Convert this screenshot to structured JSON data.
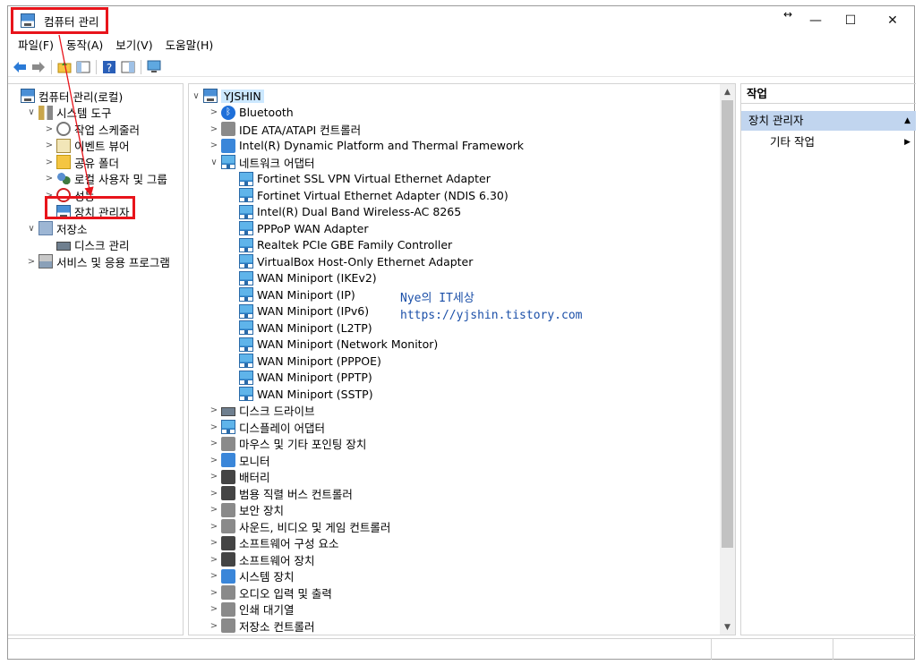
{
  "window": {
    "title": "컴퓨터 관리",
    "controls": {
      "restore": "↔",
      "minimize": "—",
      "maximize": "☐",
      "close": "✕"
    }
  },
  "menubar": [
    "파일(F)",
    "동작(A)",
    "보기(V)",
    "도움말(H)"
  ],
  "toolbar_icons": [
    "back-arrow-icon",
    "forward-arrow-icon",
    "up-folder-icon",
    "show-hide-tree-icon",
    "help-icon",
    "properties-icon",
    "monitor-icon"
  ],
  "left_tree": [
    {
      "label": "컴퓨터 관리(로컬)",
      "level": 0,
      "chev": "",
      "icon": "computer-management-icon"
    },
    {
      "label": "시스템 도구",
      "level": 1,
      "chev": "∨",
      "icon": "tools-icon"
    },
    {
      "label": "작업 스케줄러",
      "level": 2,
      "chev": ">",
      "icon": "clock-icon"
    },
    {
      "label": "이벤트 뷰어",
      "level": 2,
      "chev": ">",
      "icon": "event-viewer-icon"
    },
    {
      "label": "공유 폴더",
      "level": 2,
      "chev": ">",
      "icon": "shared-folder-icon"
    },
    {
      "label": "로컬 사용자 및 그룹",
      "level": 2,
      "chev": ">",
      "icon": "users-icon"
    },
    {
      "label": "성능",
      "level": 2,
      "chev": ">",
      "icon": "performance-icon"
    },
    {
      "label": "장치 관리자",
      "level": 2,
      "chev": "",
      "icon": "device-manager-icon",
      "selected": true
    },
    {
      "label": "저장소",
      "level": 1,
      "chev": "∨",
      "icon": "storage-icon"
    },
    {
      "label": "디스크 관리",
      "level": 2,
      "chev": "",
      "icon": "disk-icon"
    },
    {
      "label": "서비스 및 응용 프로그램",
      "level": 1,
      "chev": ">",
      "icon": "services-icon"
    }
  ],
  "device_tree": {
    "root": "YJSHIN",
    "items": [
      {
        "label": "Bluetooth",
        "level": 1,
        "chev": ">",
        "icon": "bluetooth-icon"
      },
      {
        "label": "IDE ATA/ATAPI 컨트롤러",
        "level": 1,
        "chev": ">",
        "icon": "ide-controller-icon"
      },
      {
        "label": "Intel(R) Dynamic Platform and Thermal Framework",
        "level": 1,
        "chev": ">",
        "icon": "framework-icon"
      },
      {
        "label": "네트워크 어댑터",
        "level": 1,
        "chev": "∨",
        "icon": "network-adapter-icon"
      },
      {
        "label": "Fortinet SSL VPN Virtual Ethernet Adapter",
        "level": 2,
        "chev": "",
        "icon": "network-adapter-icon"
      },
      {
        "label": "Fortinet Virtual Ethernet Adapter (NDIS 6.30)",
        "level": 2,
        "chev": "",
        "icon": "network-adapter-icon"
      },
      {
        "label": "Intel(R) Dual Band Wireless-AC 8265",
        "level": 2,
        "chev": "",
        "icon": "network-adapter-icon"
      },
      {
        "label": "PPPoP WAN Adapter",
        "level": 2,
        "chev": "",
        "icon": "network-adapter-icon"
      },
      {
        "label": "Realtek PCIe GBE Family Controller",
        "level": 2,
        "chev": "",
        "icon": "network-adapter-icon"
      },
      {
        "label": "VirtualBox Host-Only Ethernet Adapter",
        "level": 2,
        "chev": "",
        "icon": "network-adapter-icon"
      },
      {
        "label": "WAN Miniport (IKEv2)",
        "level": 2,
        "chev": "",
        "icon": "network-adapter-icon"
      },
      {
        "label": "WAN Miniport (IP)",
        "level": 2,
        "chev": "",
        "icon": "network-adapter-icon"
      },
      {
        "label": "WAN Miniport (IPv6)",
        "level": 2,
        "chev": "",
        "icon": "network-adapter-icon"
      },
      {
        "label": "WAN Miniport (L2TP)",
        "level": 2,
        "chev": "",
        "icon": "network-adapter-icon"
      },
      {
        "label": "WAN Miniport (Network Monitor)",
        "level": 2,
        "chev": "",
        "icon": "network-adapter-icon"
      },
      {
        "label": "WAN Miniport (PPPOE)",
        "level": 2,
        "chev": "",
        "icon": "network-adapter-icon"
      },
      {
        "label": "WAN Miniport (PPTP)",
        "level": 2,
        "chev": "",
        "icon": "network-adapter-icon"
      },
      {
        "label": "WAN Miniport (SSTP)",
        "level": 2,
        "chev": "",
        "icon": "network-adapter-icon"
      },
      {
        "label": "디스크 드라이브",
        "level": 1,
        "chev": ">",
        "icon": "disk-drive-icon"
      },
      {
        "label": "디스플레이 어댑터",
        "level": 1,
        "chev": ">",
        "icon": "display-adapter-icon"
      },
      {
        "label": "마우스 및 기타 포인팅 장치",
        "level": 1,
        "chev": ">",
        "icon": "mouse-icon"
      },
      {
        "label": "모니터",
        "level": 1,
        "chev": ">",
        "icon": "monitor-icon"
      },
      {
        "label": "배터리",
        "level": 1,
        "chev": ">",
        "icon": "battery-icon"
      },
      {
        "label": "범용 직렬 버스 컨트롤러",
        "level": 1,
        "chev": ">",
        "icon": "usb-icon"
      },
      {
        "label": "보안 장치",
        "level": 1,
        "chev": ">",
        "icon": "security-device-icon"
      },
      {
        "label": "사운드, 비디오 및 게임 컨트롤러",
        "level": 1,
        "chev": ">",
        "icon": "sound-icon"
      },
      {
        "label": "소프트웨어 구성 요소",
        "level": 1,
        "chev": ">",
        "icon": "software-component-icon"
      },
      {
        "label": "소프트웨어 장치",
        "level": 1,
        "chev": ">",
        "icon": "software-device-icon"
      },
      {
        "label": "시스템 장치",
        "level": 1,
        "chev": ">",
        "icon": "system-device-icon"
      },
      {
        "label": "오디오 입력 및 출력",
        "level": 1,
        "chev": ">",
        "icon": "audio-io-icon"
      },
      {
        "label": "인쇄 대기열",
        "level": 1,
        "chev": ">",
        "icon": "printer-icon"
      },
      {
        "label": "저장소 컨트롤러",
        "level": 1,
        "chev": ">",
        "icon": "storage-controller-icon"
      }
    ]
  },
  "actions": {
    "header": "작업",
    "section": "장치 관리자",
    "item": "기타 작업"
  },
  "watermark": {
    "line1": "Nye의 IT세상",
    "line2": "https://yjshin.tistory.com"
  }
}
